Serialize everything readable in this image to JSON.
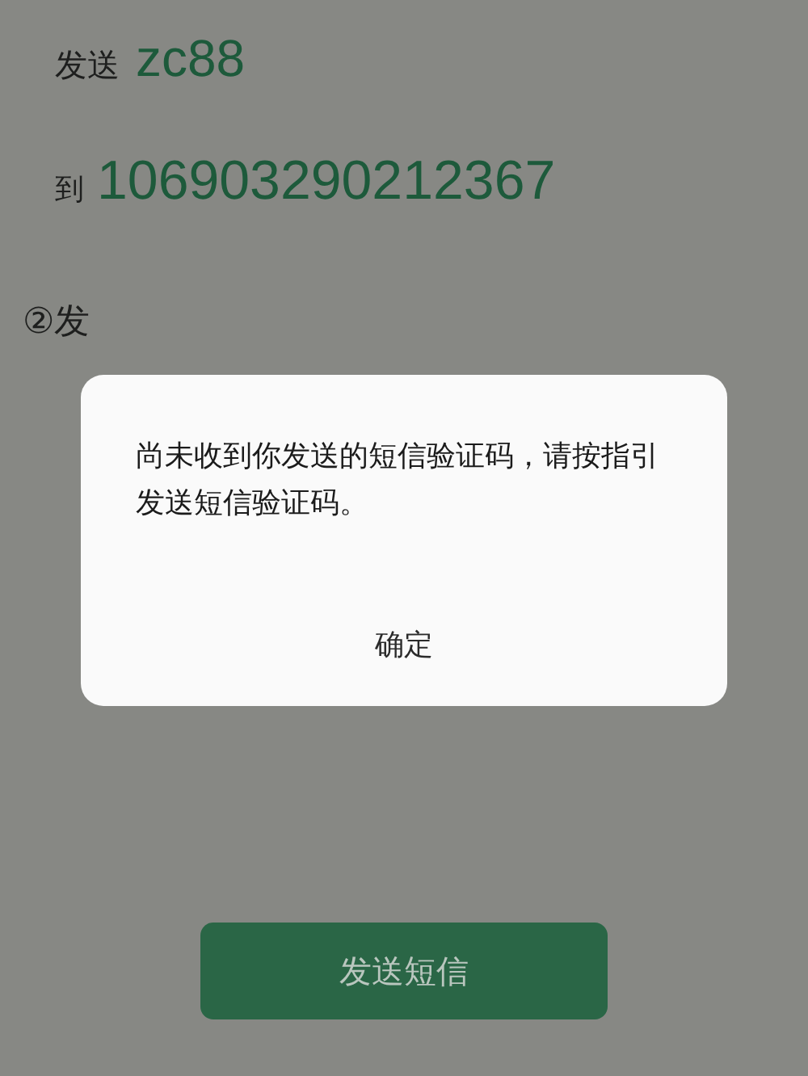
{
  "sender": {
    "label": "发送",
    "value": "zc88"
  },
  "recipient": {
    "label": "到",
    "value": "106903290212367"
  },
  "instruction": "②发",
  "dialog": {
    "message": "尚未收到你发送的短信验证码，请按指引发送短信验证码。",
    "button": "确定"
  },
  "send_button": "发送短信"
}
